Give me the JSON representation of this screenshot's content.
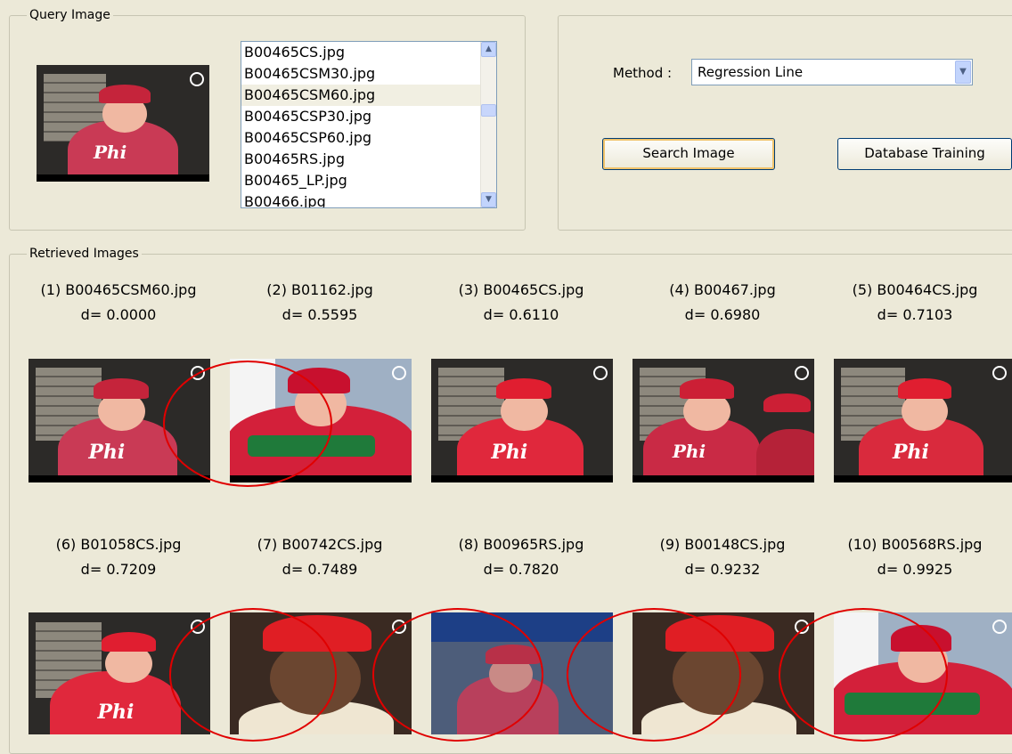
{
  "query": {
    "group_title": "Query Image",
    "files": [
      "B00465CS.jpg",
      "B00465CSM30.jpg",
      "B00465CSM60.jpg",
      "B00465CSP30.jpg",
      "B00465CSP60.jpg",
      "B00465RS.jpg",
      "B00465_LP.jpg",
      "B00466.jpg"
    ],
    "selected_index": 2
  },
  "controls": {
    "method_label": "Method :",
    "method_value": "Regression Line",
    "search_button": "Search Image",
    "training_button": "Database Training"
  },
  "retrieved": {
    "group_title": "Retrieved Images",
    "items": [
      {
        "caption": "(1) B00465CSM60.jpg",
        "distance": "d=   0.0000"
      },
      {
        "caption": "(2) B01162.jpg",
        "distance": "d=   0.5595"
      },
      {
        "caption": "(3) B00465CS.jpg",
        "distance": "d=   0.6110"
      },
      {
        "caption": "(4) B00467.jpg",
        "distance": "d=   0.6980"
      },
      {
        "caption": "(5) B00464CS.jpg",
        "distance": "d=   0.7103"
      },
      {
        "caption": "(6) B01058CS.jpg",
        "distance": "d=   0.7209"
      },
      {
        "caption": "(7) B00742CS.jpg",
        "distance": "d=   0.7489"
      },
      {
        "caption": "(8) B00965RS.jpg",
        "distance": "d=   0.7820"
      },
      {
        "caption": "(9) B00148CS.jpg",
        "distance": "d=   0.9232"
      },
      {
        "caption": "(10) B00568RS.jpg",
        "distance": "d=   0.9925"
      }
    ]
  },
  "colors": {
    "window_bg": "#ece9d8",
    "annotation_ring": "#e00000",
    "jersey_red": "#d3203a",
    "list_border": "#7f9db9"
  },
  "icons": [
    "scroll-up-arrow-icon",
    "scroll-down-arrow-icon",
    "dropdown-arrow-icon"
  ]
}
